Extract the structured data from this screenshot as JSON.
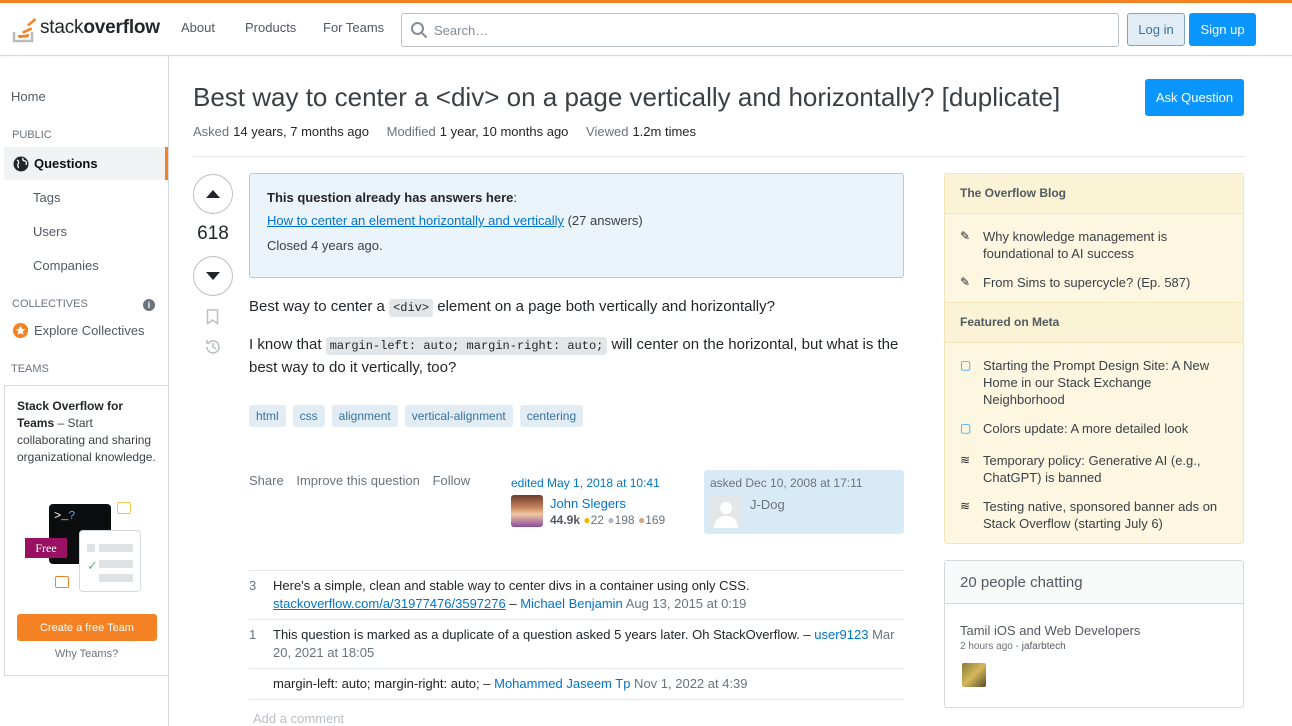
{
  "header": {
    "logo_prefix": "stack",
    "logo_bold": "overflow",
    "nav": [
      "About",
      "Products",
      "For Teams"
    ],
    "search_placeholder": "Search…",
    "login": "Log in",
    "signup": "Sign up"
  },
  "left_nav": {
    "home": "Home",
    "public_label": "PUBLIC",
    "questions": "Questions",
    "tags": "Tags",
    "users": "Users",
    "companies": "Companies",
    "collectives_label": "COLLECTIVES",
    "explore_collectives": "Explore Collectives",
    "teams_label": "TEAMS",
    "teams_promo_bold": "Stack Overflow for Teams",
    "teams_promo_rest": " – Start collaborating and sharing organizational knowledge.",
    "free_badge": "Free",
    "create_team": "Create a free Team",
    "why_teams": "Why Teams?"
  },
  "question": {
    "title": "Best way to center a <div> on a page vertically and horizontally? [duplicate]",
    "ask_button": "Ask Question",
    "asked_label": "Asked",
    "asked_value": "14 years, 7 months ago",
    "modified_label": "Modified",
    "modified_value": "1 year, 10 months ago",
    "viewed_label": "Viewed",
    "viewed_value": "1.2m times",
    "votes": "618",
    "duplicate_notice": {
      "heading": "This question already has answers here",
      "colon": ":",
      "link": "How to center an element horizontally and vertically",
      "answers": " (27 answers)",
      "closed": "Closed 4 years ago."
    },
    "body_line1_pre": "Best way to center a ",
    "body_line1_code": "<div>",
    "body_line1_post": " element on a page both vertically and horizontally?",
    "body_line2_pre": "I know that ",
    "body_line2_code": "margin-left: auto; margin-right: auto;",
    "body_line2_post": " will center on the horizontal, but what is the best way to do it vertically, too?",
    "tags": [
      "html",
      "css",
      "alignment",
      "vertical-alignment",
      "centering"
    ],
    "actions": {
      "share": "Share",
      "improve": "Improve this question",
      "follow": "Follow"
    },
    "editor": {
      "edited": "edited May 1, 2018 at 10:41",
      "name": "John Slegers",
      "rep": "44.9k",
      "gold": "22",
      "silver": "198",
      "bronze": "169"
    },
    "asker": {
      "asked": "asked Dec 10, 2008 at 17:11",
      "name": "J-Dog"
    }
  },
  "comments": [
    {
      "score": "3",
      "text": "Here's a simple, clean and stable way to center divs in a container using only CSS. ",
      "link": "stackoverflow.com/a/31977476/3597276",
      "sep": " – ",
      "user": "Michael Benjamin",
      "date": " Aug 13, 2015 at 0:19"
    },
    {
      "score": "1",
      "text": "This question is marked as a duplicate of a question asked 5 years later. Oh StackOverflow. – ",
      "link": "",
      "sep": "",
      "user": "user9123",
      "date": " Mar 20, 2021 at 18:05"
    },
    {
      "score": "",
      "text": "margin-left: auto; margin-right: auto; – ",
      "link": "",
      "sep": "",
      "user": "Mohammed Jaseem Tp",
      "date": " Nov 1, 2022 at 4:39"
    }
  ],
  "add_comment": "Add a comment",
  "sidebar": {
    "blog_heading": "The Overflow Blog",
    "blog_items": [
      "Why knowledge management is foundational to AI success",
      "From Sims to supercycle? (Ep. 587)"
    ],
    "meta_heading": "Featured on Meta",
    "meta_items": [
      "Starting the Prompt Design Site: A New Home in our Stack Exchange Neighborhood",
      "Colors update: A more detailed look",
      "Temporary policy: Generative AI (e.g., ChatGPT) is banned",
      "Testing native, sponsored banner ads on Stack Overflow (starting July 6)"
    ],
    "chat_heading": "20 people chatting",
    "chat_room": "Tamil iOS and Web Developers",
    "chat_time": "2 hours ago",
    "chat_sep": " - ",
    "chat_user": "jafarbtech"
  },
  "colors": {
    "accent": "#f48225",
    "link": "#0074cc",
    "primary_button": "#0a95ff"
  }
}
